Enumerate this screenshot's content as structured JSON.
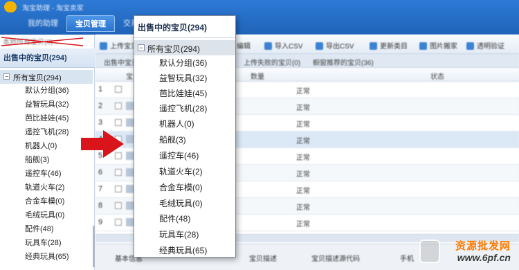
{
  "header": {
    "app_title": "淘宝助理 - 淘宝卖家",
    "nav": [
      "我的助理",
      "宝贝管理",
      "交易管理"
    ]
  },
  "sidebar": {
    "struck_label": "本地所有宝贝(0)",
    "title": "出售中的宝贝(294)",
    "root": "所有宝贝(294)",
    "root_toggle": "−",
    "items": [
      "默认分组(36)",
      "益智玩具(32)",
      "芭比娃娃(45)",
      "遥控飞机(28)",
      "机器人(0)",
      "船舰(3)",
      "遥控车(46)",
      "轨道火车(2)",
      "合金车模(0)",
      "毛绒玩具(0)",
      "配件(48)",
      "玩具车(28)",
      "经典玩具(65)"
    ]
  },
  "toolbar": {
    "items": [
      "上传宝贝",
      "编辑",
      "导入CSV",
      "导出CSV",
      "更新类目",
      "图片搬家",
      "透明验证"
    ]
  },
  "subtabs": [
    "出售中宝贝",
    "上传失败的宝贝(0)",
    "橱窗推荐的宝贝(36)"
  ],
  "table": {
    "columns": [
      "宝贝",
      "数量",
      "状态"
    ],
    "row_numbers": [
      "1",
      "2",
      "3",
      "4",
      "5",
      "6",
      "7",
      "8",
      "9"
    ],
    "status_value": "正常"
  },
  "bottom_tabs": [
    "基本信息",
    "宝贝描述",
    "宝贝描述源代码",
    "手机"
  ],
  "popup": {
    "title": "出售中的宝贝(294)",
    "root": "所有宝贝(294)",
    "root_toggle": "−",
    "items": [
      "默认分组(36)",
      "益智玩具(32)",
      "芭比娃娃(45)",
      "遥控飞机(28)",
      "机器人(0)",
      "船舰(3)",
      "遥控车(46)",
      "轨道火车(2)",
      "合金车模(0)",
      "毛绒玩具(0)",
      "配件(48)",
      "玩具车(28)",
      "经典玩具(65)"
    ]
  },
  "watermark": {
    "cn": "资源批发网",
    "url": "www.6pf.cn"
  },
  "colors": {
    "header_blue": "#2d7ad6",
    "arrow_red": "#d9151b",
    "watermark_orange": "#ff7a00"
  }
}
